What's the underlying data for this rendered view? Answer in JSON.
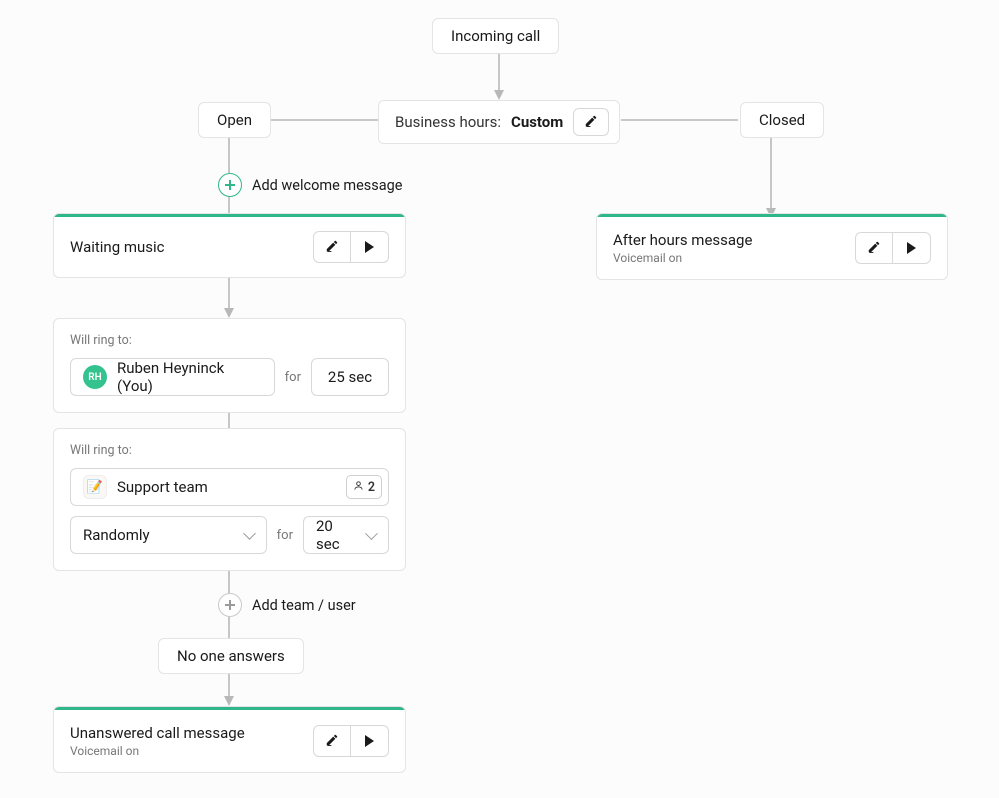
{
  "root": {
    "label": "Incoming call"
  },
  "business_hours": {
    "prefix": "Business hours:",
    "value": "Custom"
  },
  "branches": {
    "open": "Open",
    "closed": "Closed"
  },
  "add_welcome": "Add welcome message",
  "waiting_music": {
    "title": "Waiting music"
  },
  "ring1": {
    "label": "Will ring to:",
    "user": {
      "initials": "RH",
      "name": "Ruben Heyninck (You)"
    },
    "for": "for",
    "duration": "25 sec"
  },
  "ring2": {
    "label": "Will ring to:",
    "team": {
      "name": "Support team",
      "emoji": "📝",
      "count": "2"
    },
    "strategy": "Randomly",
    "for": "for",
    "duration": "20 sec"
  },
  "add_team_user": "Add team / user",
  "no_answer": "No one answers",
  "unanswered": {
    "title": "Unanswered call message",
    "sub": "Voicemail on"
  },
  "after_hours": {
    "title": "After hours message",
    "sub": "Voicemail on"
  }
}
